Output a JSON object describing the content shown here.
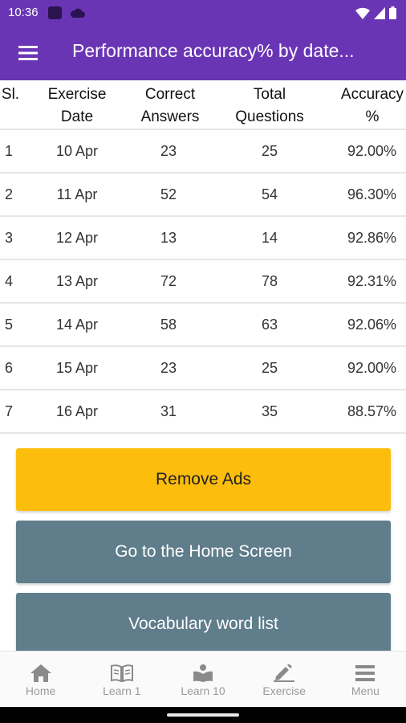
{
  "status_bar": {
    "time": "10:36"
  },
  "app_bar": {
    "title": "Performance accuracy% by date..."
  },
  "table": {
    "headers": {
      "sl": "Sl.",
      "date_1": "Exercise",
      "date_2": "Date",
      "correct_1": "Correct",
      "correct_2": "Answers",
      "total_1": "Total",
      "total_2": "Questions",
      "acc_1": "Accuracy",
      "acc_2": "%"
    },
    "rows": [
      {
        "sl": "1",
        "date": "10 Apr",
        "correct": "23",
        "total": "25",
        "accuracy": "92.00%"
      },
      {
        "sl": "2",
        "date": "11 Apr",
        "correct": "52",
        "total": "54",
        "accuracy": "96.30%"
      },
      {
        "sl": "3",
        "date": "12 Apr",
        "correct": "13",
        "total": "14",
        "accuracy": "92.86%"
      },
      {
        "sl": "4",
        "date": "13 Apr",
        "correct": "72",
        "total": "78",
        "accuracy": "92.31%"
      },
      {
        "sl": "5",
        "date": "14 Apr",
        "correct": "58",
        "total": "63",
        "accuracy": "92.06%"
      },
      {
        "sl": "6",
        "date": "15 Apr",
        "correct": "23",
        "total": "25",
        "accuracy": "92.00%"
      },
      {
        "sl": "7",
        "date": "16 Apr",
        "correct": "31",
        "total": "35",
        "accuracy": "88.57%"
      }
    ]
  },
  "buttons": {
    "remove_ads": "Remove Ads",
    "home_screen": "Go to the Home Screen",
    "vocabulary": "Vocabulary word list"
  },
  "bottom_nav": {
    "home": "Home",
    "learn1": "Learn 1",
    "learn10": "Learn 10",
    "exercise": "Exercise",
    "menu": "Menu"
  },
  "colors": {
    "primary": "#6a35b5",
    "ads_button": "#fdbd0c",
    "secondary_button": "#607d8b"
  }
}
